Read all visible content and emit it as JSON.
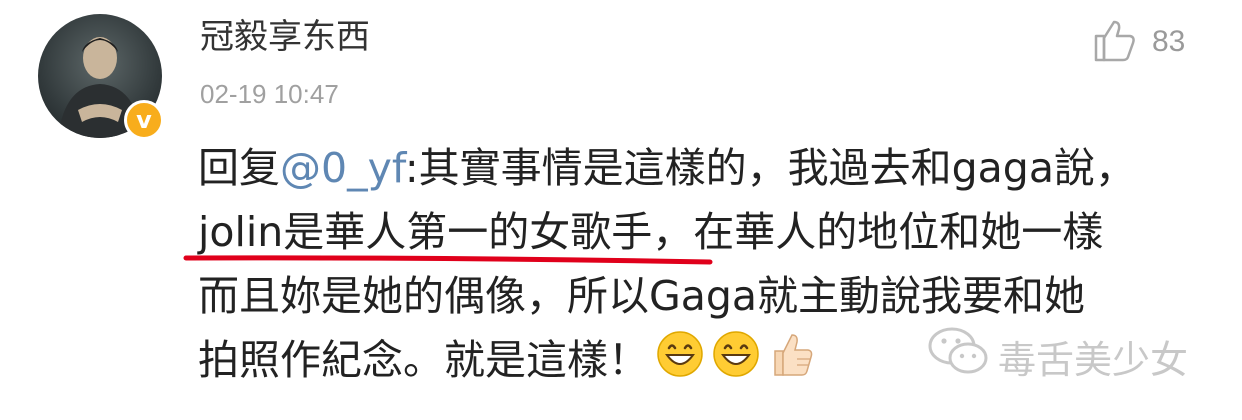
{
  "post": {
    "username": "冠毅享东西",
    "timestamp": "02-19 10:47",
    "like_count": "83",
    "comment": {
      "reply_prefix": "回复",
      "mention": "@0_yf",
      "line1_rest": ":其實事情是這樣的，我過去和gaga說，",
      "line2_highlight": "jolin是華人第一的女歌手，",
      "line2_rest": "在華人的地位和她一樣",
      "line3": "而且妳是她的偶像，所以Gaga就主動說我要和她",
      "line4": "拍照作紀念。就是這樣！"
    }
  },
  "verified_badge": "v",
  "watermark": {
    "text": "毒舌美少女"
  },
  "colors": {
    "mention": "#5f87b3",
    "underline": "#e0001b",
    "badge": "#f8ad1c",
    "meta": "#a0a0a0"
  },
  "icons": {
    "like": "thumbs-up-outline-icon",
    "emoji_1": "grinning-face-icon",
    "emoji_2": "grinning-face-icon",
    "emoji_3": "thumbs-up-emoji-icon",
    "watermark": "wechat-logo-icon"
  }
}
